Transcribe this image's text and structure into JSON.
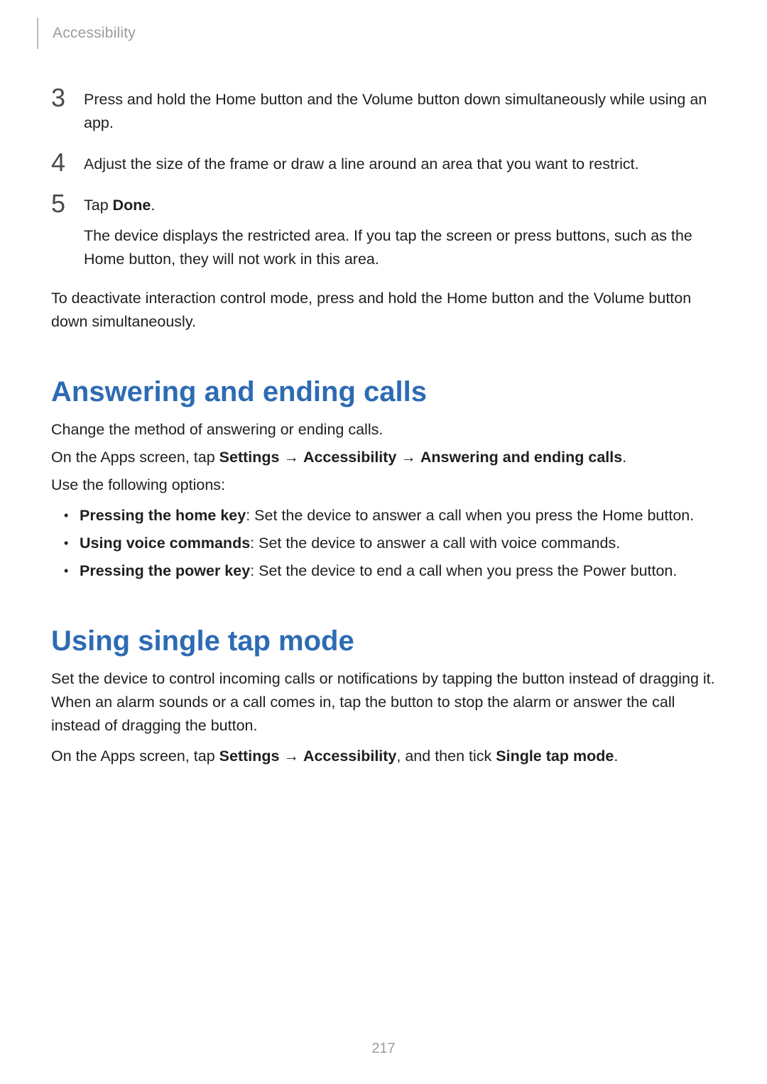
{
  "header": {
    "section": "Accessibility"
  },
  "steps": {
    "s3": {
      "num": "3",
      "text": "Press and hold the Home button and the Volume button down simultaneously while using an app."
    },
    "s4": {
      "num": "4",
      "text": "Adjust the size of the frame or draw a line around an area that you want to restrict."
    },
    "s5": {
      "num": "5",
      "tap": "Tap ",
      "done": "Done",
      "period": ".",
      "sub": "The device displays the restricted area. If you tap the screen or press buttons, such as the Home button, they will not work in this area."
    }
  },
  "closing": "To deactivate interaction control mode, press and hold the Home button and the Volume button down simultaneously.",
  "answering": {
    "title": "Answering and ending calls",
    "intro": "Change the method of answering or ending calls.",
    "path_prefix": "On the Apps screen, tap ",
    "path_settings": "Settings",
    "arrow": " → ",
    "path_accessibility": "Accessibility",
    "path_target": "Answering and ending calls",
    "path_period": ".",
    "options_intro": "Use the following options:",
    "opts": {
      "o1_b": "Pressing the home key",
      "o1_r": ": Set the device to answer a call when you press the Home button.",
      "o2_b": "Using voice commands",
      "o2_r": ": Set the device to answer a call with voice commands.",
      "o3_b": "Pressing the power key",
      "o3_r": ": Set the device to end a call when you press the Power button."
    }
  },
  "singletap": {
    "title": "Using single tap mode",
    "p1": "Set the device to control incoming calls or notifications by tapping the button instead of dragging it. When an alarm sounds or a call comes in, tap the button to stop the alarm or answer the call instead of dragging the button.",
    "p2_prefix": "On the Apps screen, tap ",
    "p2_settings": "Settings",
    "arrow": " → ",
    "p2_accessibility": "Accessibility",
    "p2_mid": ", and then tick ",
    "p2_target": "Single tap mode",
    "p2_period": "."
  },
  "page_number": "217"
}
